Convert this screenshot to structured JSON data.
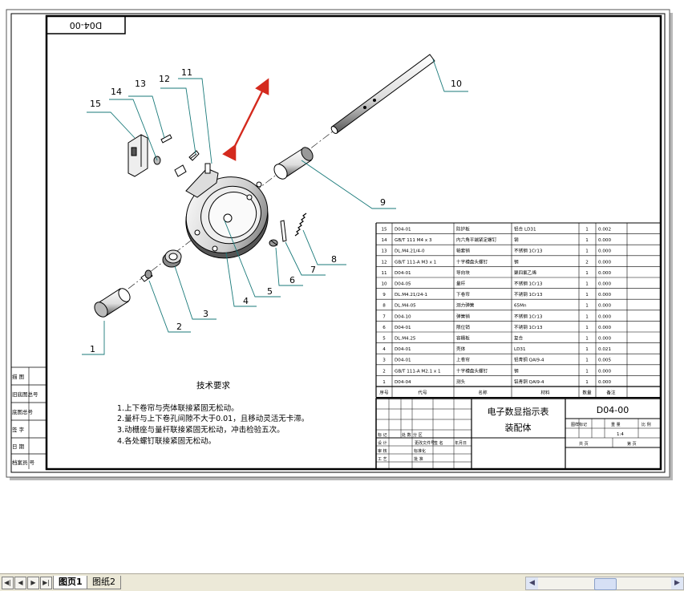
{
  "drawing": {
    "corner_code": "D04-00",
    "title_line1": "电子数显指示表",
    "title_line2": "装配体",
    "drawing_no": "D04-00",
    "scale": "1:1",
    "ratio_text": "1:4",
    "tech_title": "技术要求",
    "tech_reqs": [
      "1.上下卷帘与壳体联接紧固无松动。",
      "2.量杆与上下卷孔间隙不大于0.01，且移动灵活无卡滞。",
      "3.动栅座与量杆联接紧固无松动，冲击检验五次。",
      "4.各处螺钉联接紧固无松动。"
    ],
    "callouts": [
      "1",
      "2",
      "3",
      "4",
      "5",
      "6",
      "7",
      "8",
      "9",
      "10",
      "11",
      "12",
      "13",
      "14",
      "15"
    ],
    "left_column_labels": [
      "描 图",
      "旧底图总号",
      "底图总号",
      "签 字",
      "日 期",
      "档案员 号"
    ],
    "bom_header": [
      "序号",
      "代号",
      "名称",
      "材料",
      "数量",
      "备注"
    ],
    "bom_rows": [
      [
        "15",
        "D04-01",
        "防护板",
        "铝合 LD31",
        "1",
        "0.002"
      ],
      [
        "14",
        "GB/T 111 M4 x 3",
        "内六角平端紧定螺钉",
        "钢",
        "1",
        "0.000"
      ],
      [
        "13",
        "DL.M4.21/4-0",
        "轴套销",
        "不锈钢 1Cr13",
        "1",
        "0.000"
      ],
      [
        "12",
        "GB/T 111-A M3 x 1",
        "十字槽盘头螺钉",
        "钢",
        "2",
        "0.000"
      ],
      [
        "11",
        "D04-01",
        "导向块",
        "聚四氟乙烯",
        "1",
        "0.000"
      ],
      [
        "10",
        "D04-05",
        "量杆",
        "不锈钢 1Cr13",
        "1",
        "0.000"
      ],
      [
        "9",
        "DL.M4.21/24-1",
        "下卷帘",
        "不锈钢 1Cr13",
        "1",
        "0.000"
      ],
      [
        "8",
        "DL.M4-05",
        "测力弹簧",
        "65Mn",
        "1",
        "0.000"
      ],
      [
        "7",
        "D04-10",
        "弹簧销",
        "不锈钢 1Cr13",
        "1",
        "0.000"
      ],
      [
        "6",
        "D04-01",
        "限位销",
        "不锈钢 1Cr13",
        "1",
        "0.000"
      ],
      [
        "5",
        "DL.M4.25",
        "容栅板",
        "复合",
        "1",
        "0.000"
      ],
      [
        "4",
        "D04-01",
        "壳体",
        "LD31",
        "1",
        "0.021"
      ],
      [
        "3",
        "D04-01",
        "上卷帘",
        "铝青铜 QAl9-4",
        "1",
        "0.005"
      ],
      [
        "2",
        "GB/T 111-A M2.1 x 1",
        "十字槽盘头螺钉",
        "钢",
        "1",
        "0.000"
      ],
      [
        "1",
        "D04-04",
        "测头",
        "铝青铜 QAl9-4",
        "1",
        "0.000"
      ]
    ],
    "tb_labels": [
      "标 记",
      "处 数",
      "分 区",
      "更改文件号",
      "签 名",
      "年月日",
      "设 计",
      "标准化",
      "审 核",
      "工 艺",
      "批 准",
      "图样标记",
      "重 量",
      "比 例",
      "共 页",
      "第 页"
    ]
  },
  "tabs": {
    "sheet1": "图页1",
    "sheet2": "图纸2"
  },
  "nav": [
    "◀|",
    "◀",
    "▶",
    "▶|"
  ],
  "scroll": {
    "left": "◀",
    "right": "▶"
  },
  "colors": {
    "leader": "#1a7a7a",
    "arrow": "#d42a1e",
    "paper_shadow": "#b8b8b8"
  }
}
